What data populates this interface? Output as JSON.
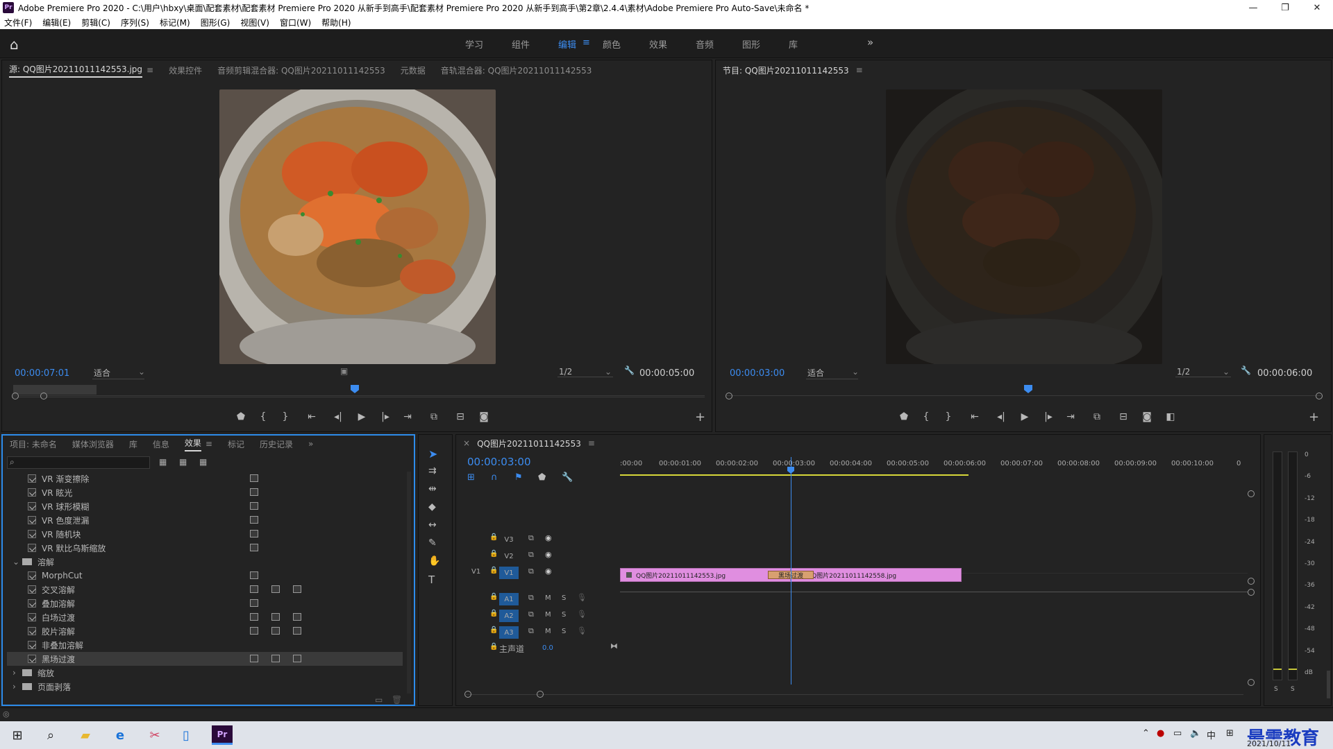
{
  "app": {
    "title": "Adobe Premiere Pro 2020 - C:\\用户\\hbxy\\桌面\\配套素材\\配套素材 Premiere Pro 2020 从新手到高手\\配套素材 Premiere Pro 2020 从新手到高手\\第2章\\2.4.4\\素材\\Adobe Premiere Pro Auto-Save\\未命名 *",
    "logo": "Pr",
    "window_controls": [
      "—",
      "❐",
      "✕"
    ]
  },
  "menu": [
    "文件(F)",
    "编辑(E)",
    "剪辑(C)",
    "序列(S)",
    "标记(M)",
    "图形(G)",
    "视图(V)",
    "窗口(W)",
    "帮助(H)"
  ],
  "workspaces": {
    "tabs": [
      "学习",
      "组件",
      "编辑",
      "颜色",
      "效果",
      "音频",
      "图形",
      "库"
    ],
    "active": "编辑",
    "more": "»"
  },
  "source_panel": {
    "tabs": [
      "源: QQ图片20211011142553.jpg",
      "效果控件",
      "音频剪辑混合器: QQ图片20211011142553",
      "元数据",
      "音轨混合器: QQ图片20211011142553"
    ],
    "timecode": "00:00:07:01",
    "fit": "适合",
    "resolution": "1/2",
    "duration": "00:00:05:00"
  },
  "program_panel": {
    "tab": "节目: QQ图片20211011142553",
    "timecode": "00:00:03:00",
    "fit": "适合",
    "resolution": "1/2",
    "duration": "00:00:06:00"
  },
  "project_panel": {
    "tabs": [
      "项目: 未命名",
      "媒体浏览器",
      "库",
      "信息",
      "效果",
      "标记",
      "历史记录"
    ],
    "active_tab": "效果",
    "search_placeholder": "",
    "items": [
      {
        "label": "VR 渐变擦除",
        "type": "effect",
        "icons": 1
      },
      {
        "label": "VR 眩光",
        "type": "effect",
        "icons": 1
      },
      {
        "label": "VR 球形模糊",
        "type": "effect",
        "icons": 1
      },
      {
        "label": "VR 色度泄漏",
        "type": "effect",
        "icons": 1
      },
      {
        "label": "VR 随机块",
        "type": "effect",
        "icons": 1
      },
      {
        "label": "VR 默比乌斯缩放",
        "type": "effect",
        "icons": 1
      },
      {
        "label": "溶解",
        "type": "folder-open"
      },
      {
        "label": "MorphCut",
        "type": "effect",
        "icons": 1
      },
      {
        "label": "交叉溶解",
        "type": "effect",
        "icons": 3
      },
      {
        "label": "叠加溶解",
        "type": "effect",
        "icons": 1
      },
      {
        "label": "白场过渡",
        "type": "effect",
        "icons": 3
      },
      {
        "label": "胶片溶解",
        "type": "effect",
        "icons": 3
      },
      {
        "label": "非叠加溶解",
        "type": "effect",
        "icons": 0
      },
      {
        "label": "黑场过渡",
        "type": "effect",
        "icons": 3,
        "selected": true
      },
      {
        "label": "缩放",
        "type": "folder"
      },
      {
        "label": "页面剥落",
        "type": "folder"
      }
    ]
  },
  "timeline": {
    "tab": "QQ图片20211011142553",
    "timecode": "00:00:03:00",
    "ruler": [
      ":00:00",
      "00:00:01:00",
      "00:00:02:00",
      "00:00:03:00",
      "00:00:04:00",
      "00:00:05:00",
      "00:00:06:00",
      "00:00:07:00",
      "00:00:08:00",
      "00:00:09:00",
      "00:00:10:00",
      "0"
    ],
    "video_tracks": [
      "V3",
      "V2",
      "V1"
    ],
    "audio_tracks": [
      "A1",
      "A2",
      "A3"
    ],
    "source_patch": "V1",
    "master": {
      "label": "主声道",
      "value": "0.0"
    },
    "clips": [
      {
        "label": "QQ图片20211011142553.jpg",
        "start": 0,
        "end": 3
      },
      {
        "label": "QQ图片20211011142558.jpg",
        "start": 3,
        "end": 6
      }
    ],
    "transition": "黑场过渡",
    "playhead": 3,
    "track_buttons": {
      "mute": "M",
      "solo": "S"
    }
  },
  "audio_meter": {
    "ticks": [
      "0",
      "-6",
      "-12",
      "-18",
      "-24",
      "-30",
      "-36",
      "-42",
      "-48",
      "-54",
      "dB"
    ],
    "solo": [
      "S",
      "S"
    ]
  },
  "taskbar": {
    "time": "2021/10/11",
    "ime": "中",
    "watermark": "最需教育",
    "icons": [
      "windows-start",
      "search",
      "file-explorer",
      "edge",
      "snipping-tool",
      "phone-app",
      "premiere-pro"
    ]
  }
}
